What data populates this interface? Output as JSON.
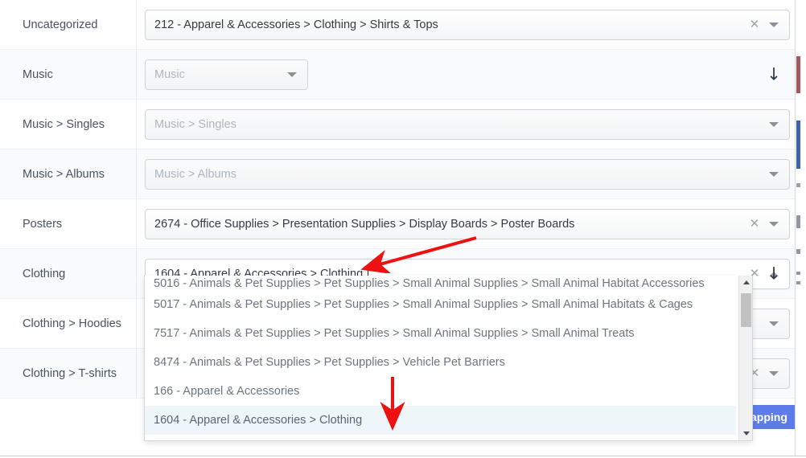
{
  "colors": {
    "accent_button": "#5d7ce8",
    "annotation_arrow": "#ee1111",
    "row_alt_bg": "#f8fafc",
    "selected_item_bg": "#eff6fa",
    "label_text": "#495260",
    "placeholder_text": "#adb5bd"
  },
  "rows": [
    {
      "label": "Uncategorized",
      "value": "212 - Apparel & Accessories > Clothing > Shirts & Tops",
      "placeholder": "",
      "filled": true,
      "has_clear": true,
      "caret": "chevron-down",
      "indicator": "",
      "alt": false,
      "narrow": false
    },
    {
      "label": "Music",
      "value": "",
      "placeholder": "Music",
      "filled": false,
      "has_clear": false,
      "caret": "chevron-down",
      "indicator": "↓",
      "alt": true,
      "narrow": true
    },
    {
      "label": "Music > Singles",
      "value": "",
      "placeholder": "Music > Singles",
      "filled": false,
      "has_clear": false,
      "caret": "chevron-down",
      "indicator": "",
      "alt": false,
      "narrow": false
    },
    {
      "label": "Music > Albums",
      "value": "",
      "placeholder": "Music > Albums",
      "filled": false,
      "has_clear": false,
      "caret": "chevron-down",
      "indicator": "",
      "alt": true,
      "narrow": false
    },
    {
      "label": "Posters",
      "value": "2674 - Office Supplies > Presentation Supplies > Display Boards > Poster Boards",
      "placeholder": "",
      "filled": true,
      "has_clear": true,
      "caret": "chevron-down",
      "indicator": "",
      "alt": false,
      "narrow": false
    },
    {
      "label": "Clothing",
      "value": "1604 - Apparel & Accessories > Clothing",
      "placeholder": "",
      "filled": true,
      "has_clear": true,
      "caret": "chevron-up",
      "indicator": "↓",
      "alt": true,
      "narrow": false,
      "editing": true
    },
    {
      "label": "Clothing > Hoodies",
      "value": "",
      "placeholder": "",
      "filled": false,
      "has_clear": false,
      "caret": "chevron-down",
      "indicator": "",
      "alt": false,
      "narrow": false
    },
    {
      "label": "Clothing > T-shirts",
      "value": "",
      "placeholder": "",
      "filled": false,
      "has_clear": true,
      "caret": "chevron-down",
      "indicator": "",
      "alt": true,
      "narrow": false
    }
  ],
  "dropdown": {
    "items": [
      {
        "text": "5016 - Animals & Pet Supplies > Pet Supplies > Small Animal Supplies > Small Animal Habitat Accessories",
        "selected": false,
        "clipped": true
      },
      {
        "text": "5017 - Animals & Pet Supplies > Pet Supplies > Small Animal Supplies > Small Animal Habitats & Cages",
        "selected": false,
        "clipped": false
      },
      {
        "text": "7517 - Animals & Pet Supplies > Pet Supplies > Small Animal Supplies > Small Animal Treats",
        "selected": false,
        "clipped": false
      },
      {
        "text": "8474 - Animals & Pet Supplies > Pet Supplies > Vehicle Pet Barriers",
        "selected": false,
        "clipped": false
      },
      {
        "text": "166 - Apparel & Accessories",
        "selected": false,
        "clipped": false
      },
      {
        "text": "1604 - Apparel & Accessories > Clothing",
        "selected": true,
        "clipped": false
      }
    ]
  },
  "save_button": {
    "label": "apping"
  }
}
